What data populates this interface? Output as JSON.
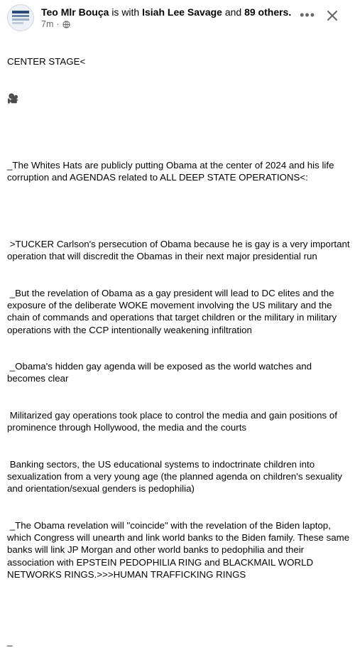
{
  "header": {
    "author": "Teo Mlr Bouça",
    "is_with": "is with",
    "tagged": "Isiah Lee Savage",
    "and": "and",
    "others": "89 others.",
    "time": "7m",
    "dot": "·"
  },
  "post": {
    "line1": "CENTER STAGE<",
    "emoji": "🎥",
    "para1": "_The Whites Hats are publicly putting Obama at the center of 2024 and his life corruption and AGENDAS related to ALL DEEP STATE OPERATIONS<:",
    "para2": " >TUCKER Carlson's persecution of Obama because he is gay is a very important operation that will discredit the Obamas in their next major presidential run",
    "para3": " _But the revelation of Obama as a gay president will lead to DC elites and the exposure of the deliberate WOKE movement involving the US military and the chain of commands and operations that target children or the military in military operations with the CCP intentionally weakening infiltration",
    "para4": " _Obama's hidden gay agenda will be exposed as the world watches and becomes clear",
    "para5": " Militarized gay operations took place to control the media and gain positions of prominence through Hollywood, the media and the courts",
    "para6": " Banking sectors, the US educational systems to indoctrinate children into sexualization from a very young age (the planned agenda on children's sexuality and orientation/sexual genders is pedophilia)",
    "para7": " _The Obama revelation will \"coincide\" with the revelation of the Biden laptop, which Congress will unearth and link world banks to the Biden family. These same banks will link JP Morgan and other world banks to pedophilia and their association with EPSTEIN PEDOPHILIA RING and BLACKMAIL WORLD NETWORKS RINGS.>>>HUMAN TRAFFICKING RINGS",
    "trailing": "_"
  },
  "icons": {
    "more": "ellipsis-icon",
    "close": "close-icon",
    "audience": "globe-icon"
  }
}
